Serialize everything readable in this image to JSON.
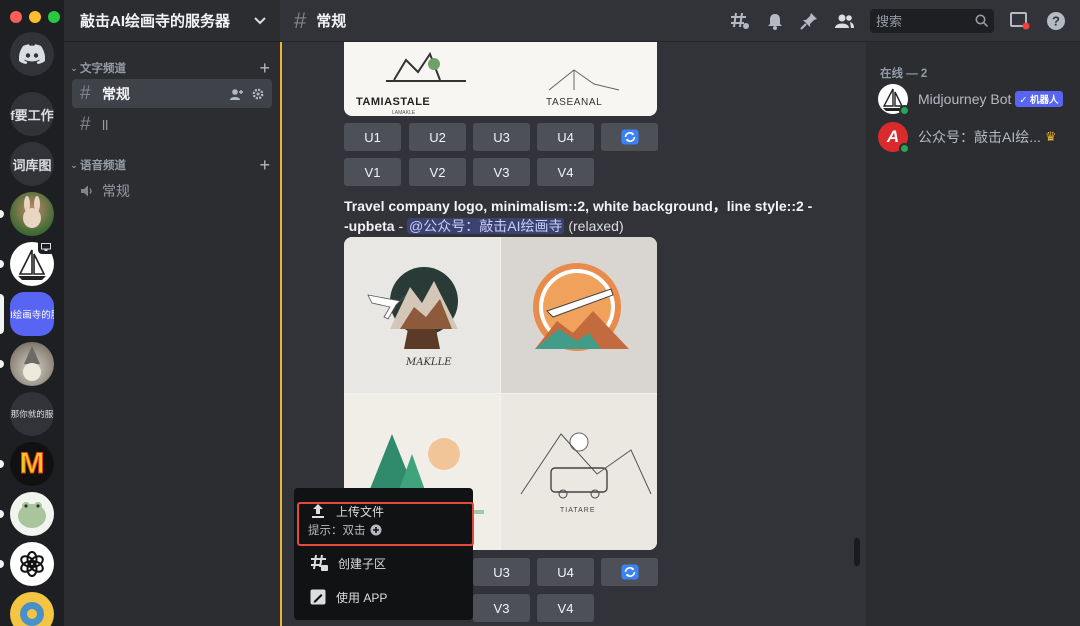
{
  "window": {
    "traffic_colors": [
      "#ff5f57",
      "#febc2e",
      "#28c840"
    ]
  },
  "servers": [
    {
      "id": "discord-home",
      "label": ""
    },
    {
      "id": "server-text-1",
      "label": "f要工作"
    },
    {
      "id": "server-text-2",
      "label": "词库图"
    },
    {
      "id": "server-rabbit",
      "label": ""
    },
    {
      "id": "server-boat",
      "label": ""
    },
    {
      "id": "server-selected",
      "label": "AI绘画寺的服"
    },
    {
      "id": "server-wizard",
      "label": ""
    },
    {
      "id": "server-text-3",
      "label": "那你就的服"
    },
    {
      "id": "server-m",
      "label": "M"
    },
    {
      "id": "server-frog",
      "label": ""
    },
    {
      "id": "server-openai",
      "label": ""
    },
    {
      "id": "server-pokemon",
      "label": ""
    }
  ],
  "sidebar": {
    "guild_name": "敲击AI绘画寺的服务器",
    "categories": [
      {
        "label": "文字频道",
        "channels": [
          {
            "label": "常规",
            "type": "text",
            "active": true
          },
          {
            "label": "ll",
            "type": "text",
            "active": false
          }
        ]
      },
      {
        "label": "语音频道",
        "channels": [
          {
            "label": "常规",
            "type": "voice",
            "active": false
          }
        ]
      }
    ]
  },
  "topbar": {
    "channel": "常规",
    "search_placeholder": "搜索"
  },
  "chat": {
    "upscale_buttons_row1": [
      "U1",
      "U2",
      "U3",
      "U4"
    ],
    "variation_buttons_row1": [
      "V1",
      "V2",
      "V3",
      "V4"
    ],
    "prompt_text": "Travel company logo, minimalism::2, white background，line style::2 --upbeta",
    "prompt_separator": " - ",
    "mention": "@公众号：敲击AI绘画寺",
    "status": "(relaxed)",
    "upscale_buttons_row2": [
      "U3",
      "U4"
    ],
    "variation_buttons_row2": [
      "V3",
      "V4"
    ],
    "image1_texts": [
      "TAMIASTALE",
      "LAMAKLE",
      "TASEANAL"
    ],
    "image2_texts": [
      "MAKLLE",
      "TIATARE"
    ]
  },
  "context_menu": {
    "items": [
      {
        "icon": "upload-icon",
        "label": "上传文件",
        "hint_prefix": "提示：双击"
      },
      {
        "icon": "thread-icon",
        "label": "创建子区"
      },
      {
        "icon": "app-icon",
        "label": "使用 APP"
      }
    ],
    "highlight_color": "#e34c3b"
  },
  "members": {
    "header": "在线 — 2",
    "list": [
      {
        "name": "Midjourney Bot",
        "tag": "✓ 机器人"
      },
      {
        "name": "公众号：敲击AI绘...",
        "crown": "♛"
      }
    ]
  }
}
